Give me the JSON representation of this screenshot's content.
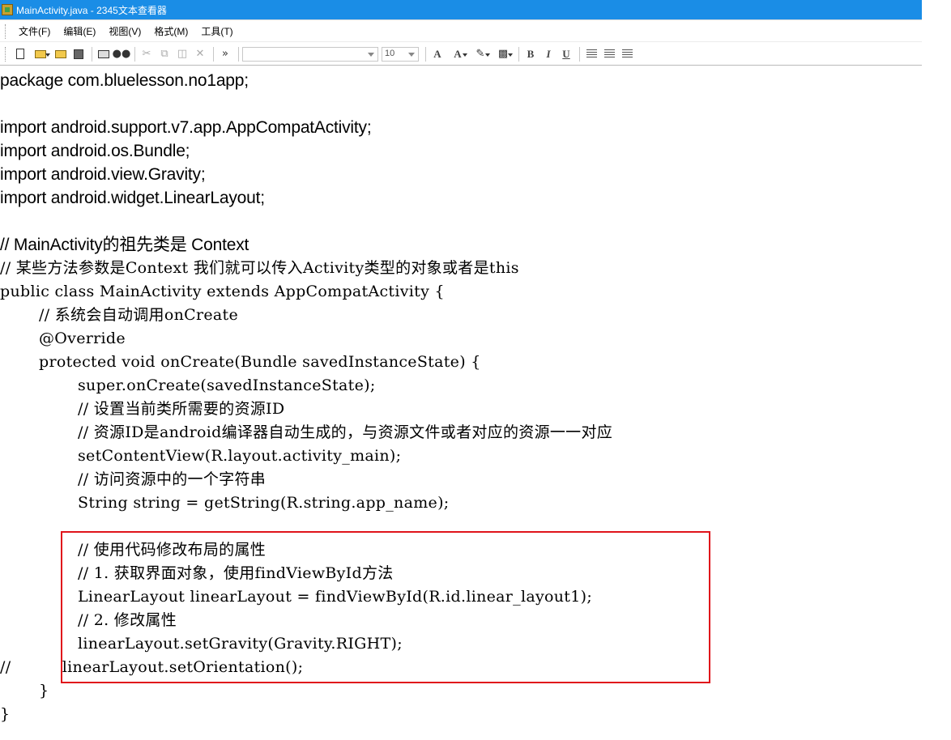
{
  "window": {
    "title": "MainActivity.java - 2345文本查看器"
  },
  "menu": [
    "文件(F)",
    "编辑(E)",
    "视图(V)",
    "格式(M)",
    "工具(T)"
  ],
  "toolbar": {
    "overflow": "»",
    "font_size": "10",
    "bold": "B",
    "italic": "I",
    "underline": "U",
    "font_color_letter": "A",
    "grow_letter": "A"
  },
  "editor": {
    "lines": [
      "package com.bluelesson.no1app;",
      "",
      "import android.support.v7.app.AppCompatActivity;",
      "import android.os.Bundle;",
      "import android.view.Gravity;",
      "import android.widget.LinearLayout;",
      "",
      "// MainActivity的祖先类是 Context",
      "// 某些方法参数是Context 我们就可以传入Activity类型的对象或者是this",
      "public class MainActivity extends AppCompatActivity {",
      "// 系统会自动调用onCreate",
      "@Override",
      "protected void onCreate(Bundle savedInstanceState) {",
      "super.onCreate(savedInstanceState);",
      "// 设置当前类所需要的资源ID",
      "// 资源ID是android编译器自动生成的，与资源文件或者对应的资源一一对应",
      "setContentView(R.layout.activity_main);",
      "// 访问资源中的一个字符串",
      "String string = getString(R.string.app_name);",
      "",
      "// 使用代码修改布局的属性",
      "// 1. 获取界面对象，使用findViewById方法",
      "LinearLayout linearLayout = findViewById(R.id.linear_layout1);",
      "// 2. 修改属性",
      "linearLayout.setGravity(Gravity.RIGHT);",
      "//          linearLayout.setOrientation();",
      "}",
      "}"
    ],
    "highlight_color": "#e0141b"
  },
  "colors": {
    "titlebar": "#1a8de6",
    "title_text": "#ffffff"
  }
}
